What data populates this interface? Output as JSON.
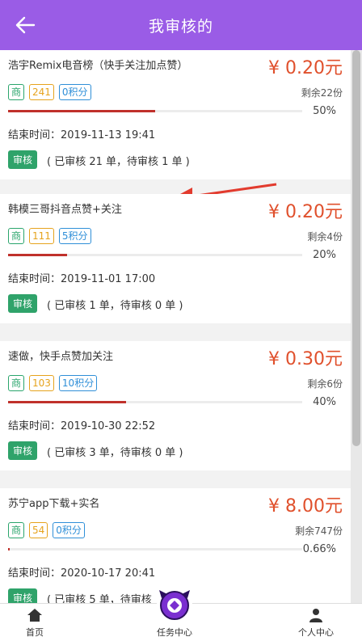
{
  "header": {
    "title": "我审核的"
  },
  "tasks": [
    {
      "name": "浩宇Remix电音榜（快手关注加点赞）",
      "price": "¥ 0.20元",
      "tag_biz": "商",
      "tag_count": "241",
      "tag_score": "0积分",
      "remaining": "剩余22份",
      "progress_pct": 50,
      "progress_label": "50%",
      "end_time": "结束时间：2019-11-13 19:41",
      "review_label": "审核",
      "review_stats": "( 已审核 21 单，待审核 1 单 )"
    },
    {
      "name": "韩模三哥抖音点赞+关注",
      "price": "¥ 0.20元",
      "tag_biz": "商",
      "tag_count": "111",
      "tag_score": "5积分",
      "remaining": "剩余4份",
      "progress_pct": 20,
      "progress_label": "20%",
      "end_time": "结束时间：2019-11-01 17:00",
      "review_label": "审核",
      "review_stats": "( 已审核 1 单，待审核 0 单 )"
    },
    {
      "name": "速做，快手点赞加关注",
      "price": "¥ 0.30元",
      "tag_biz": "商",
      "tag_count": "103",
      "tag_score": "10积分",
      "remaining": "剩余6份",
      "progress_pct": 40,
      "progress_label": "40%",
      "end_time": "结束时间：2019-10-30 22:52",
      "review_label": "审核",
      "review_stats": "( 已审核 3 单，待审核 0 单 )"
    },
    {
      "name": "苏宁app下载+实名",
      "price": "¥ 8.00元",
      "tag_biz": "商",
      "tag_count": "54",
      "tag_score": "0积分",
      "remaining": "剩余747份",
      "progress_pct": 0.66,
      "progress_label": "0.66%",
      "end_time": "结束时间：2020-10-17 20:41",
      "review_label": "审核",
      "review_stats": "( 已审核 5 单，待审核"
    }
  ],
  "tabbar": {
    "home": "首页",
    "tasks": "任务中心",
    "profile": "个人中心"
  },
  "colors": {
    "header": "#9a5ce6",
    "price": "#e0502c",
    "review": "#2fa36a",
    "progress": "#c0312b"
  }
}
